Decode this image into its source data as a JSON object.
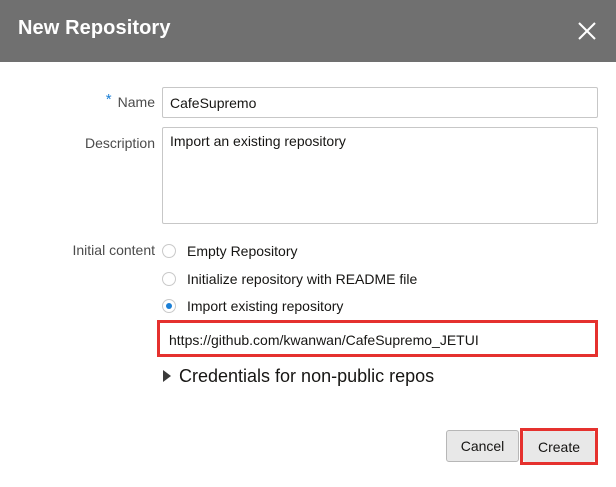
{
  "dialog": {
    "title": "New Repository",
    "close_icon": "close-icon"
  },
  "form": {
    "name": {
      "label": "Name",
      "required_marker": "*",
      "value": "CafeSupremo"
    },
    "description": {
      "label": "Description",
      "value": "Import an existing repository"
    },
    "initial_content": {
      "label": "Initial content",
      "options": [
        {
          "label": "Empty Repository",
          "selected": false
        },
        {
          "label": "Initialize repository with README file",
          "selected": false
        },
        {
          "label": "Import existing repository",
          "selected": true
        }
      ],
      "import_url": "https://github.com/kwanwan/CafeSupremo_JETUI"
    },
    "credentials": {
      "label": "Credentials for non-public repos",
      "expanded": false
    }
  },
  "footer": {
    "cancel_label": "Cancel",
    "create_label": "Create"
  },
  "colors": {
    "titlebar": "#707070",
    "accent": "#1b7fd6",
    "highlight": "#e5312e"
  }
}
